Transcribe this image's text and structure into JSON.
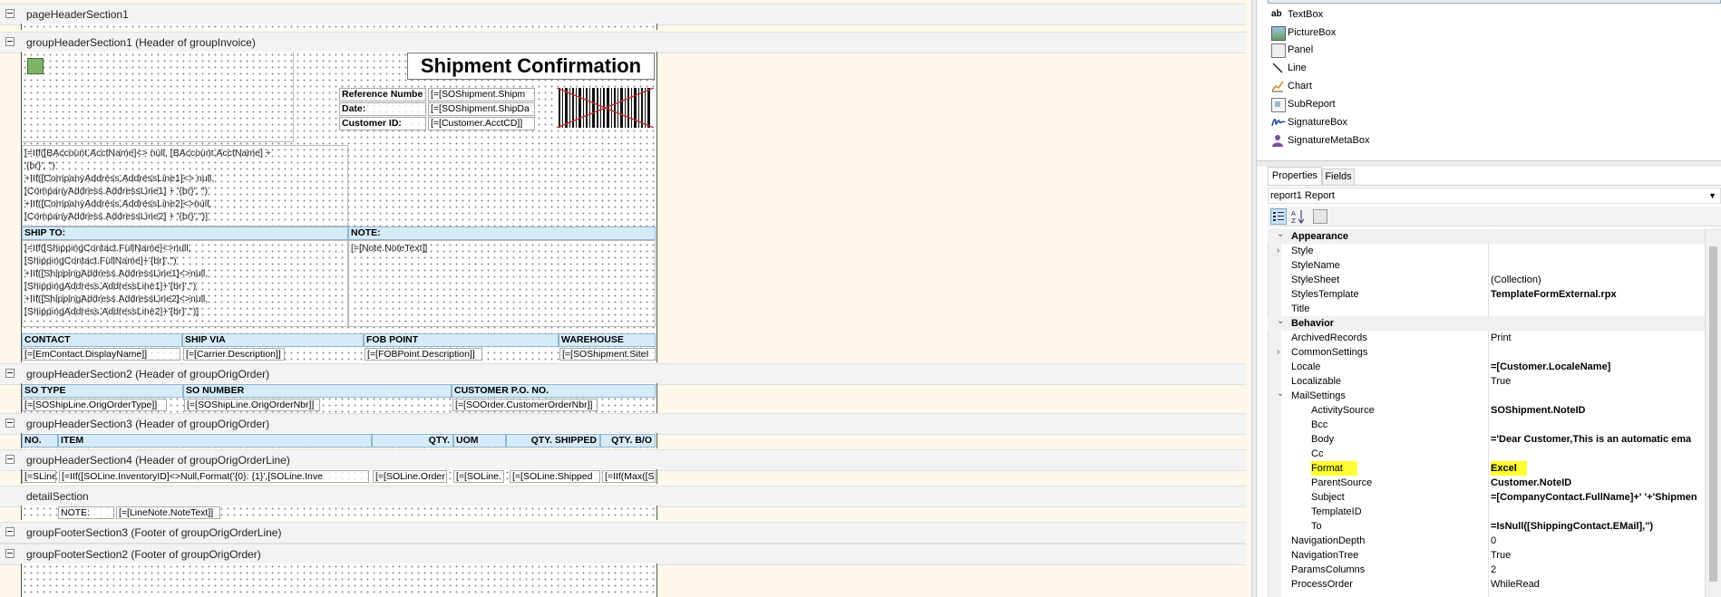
{
  "sections": {
    "page_header_1": "pageHeaderSection1",
    "group_header_1": "groupHeaderSection1 (Header of groupInvoice)",
    "group_header_2": "groupHeaderSection2 (Header of groupOrigOrder)",
    "group_header_3": "groupHeaderSection3 (Header of groupOrigOrder)",
    "group_header_4": "groupHeaderSection4 (Header of groupOrigOrderLine)",
    "detail": "detailSection",
    "group_footer_3": "groupFooterSection3 (Footer of groupOrigOrderLine)",
    "group_footer_2": "groupFooterSection2 (Footer of groupOrigOrder)"
  },
  "report": {
    "title": "Shipment Confirmation",
    "ref_label": "Reference Numbe",
    "ref_value": "[=[SOShipment.Shipm",
    "date_label": "Date:",
    "date_value": "[=[SOShipment.ShipDa",
    "cust_label": "Customer ID:",
    "cust_value": "[=[Customer.AcctCD]]",
    "addr_lines": [
      "[=IIf([BAccount.AcctName]<> null, [BAccount.AcctName] +",
      "'{br}', '')",
      "+IIf([CompanyAddress.AddressLine1]<> null,",
      "[CompanyAddress.AddressLine1] + '{br}', '')",
      "+IIf([CompanyAddress.AddressLine2]<>null,",
      "[CompanyAddress.AddressLine2] + '{br}','')]"
    ],
    "ship_to_label": "SHIP TO:",
    "note_label": "NOTE:",
    "ship_lines": [
      "[=IIf([ShippingContact.FullName]<>null,",
      "[ShippingContact.FullName]+'{br}','')",
      "+IIf([ShippingAddress.AddressLine1]<>null,",
      "[ShippingAddress.AddressLine1]+'{br}','')",
      "+IIf([ShippingAddress.AddressLine2]<>null,",
      "[ShippingAddress.AddressLine2]+'{br}','')]"
    ],
    "note_text": "[=[Note.NoteText]]",
    "contact_hdr": "CONTACT",
    "shipvia_hdr": "SHIP VIA",
    "fob_hdr": "FOB POINT",
    "warehouse_hdr": "WAREHOUSE",
    "contact_val": "[=[EmContact.DisplayName]]",
    "shipvia_val": "[=[Carrier.Description]]",
    "fob_val": "[=[FOBPoint.Description]]",
    "warehouse_val": "[=[SOShipment.SiteI",
    "sotype_hdr": "SO TYPE",
    "sonumber_hdr": "SO NUMBER",
    "custpo_hdr": "CUSTOMER P.O. NO.",
    "sotype_val": "[=[SOShipLine.OrigOrderType]]",
    "sonumber_val": "[=[SOShipLine.OrigOrderNbr]]",
    "custpo_val": "[=[SOOrder.CustomerOrderNbr]]",
    "no_hdr": "NO.",
    "item_hdr": "ITEM",
    "qty_hdr": "QTY.",
    "uom_hdr": "UOM",
    "qtyshipped_hdr": "QTY. SHIPPED",
    "qtybo_hdr": "QTY. B/O",
    "line_vals": [
      "[=SLine",
      "[=IIf([SOLine.InventoryID]<>Null,Format('{0}: {1}',[SOLine.Inve",
      "[=[SOLine.Order",
      "[=[SOLine.",
      "[=[SOLine.Shipped",
      "[=IIf(Max([SOS"
    ],
    "detail_note_label": "NOTE:",
    "detail_note_val": "[=[LineNote.NoteText]]"
  },
  "toolbox": {
    "items": [
      {
        "label": "TextBox",
        "icon": "textbox-icon"
      },
      {
        "label": "PictureBox",
        "icon": "picturebox-icon"
      },
      {
        "label": "Panel",
        "icon": "panel-icon"
      },
      {
        "label": "Line",
        "icon": "line-icon"
      },
      {
        "label": "Chart",
        "icon": "chart-icon"
      },
      {
        "label": "SubReport",
        "icon": "subreport-icon"
      },
      {
        "label": "SignatureBox",
        "icon": "signaturebox-icon"
      },
      {
        "label": "SignatureMetaBox",
        "icon": "signaturemetabox-icon"
      }
    ],
    "textbox_glyph": "ab"
  },
  "properties": {
    "tab_properties": "Properties",
    "tab_fields": "Fields",
    "object_selector": "report1 Report",
    "highlight_color": "#ffff33",
    "rows": [
      {
        "name": "Appearance",
        "value": "",
        "cat": true
      },
      {
        "name": "Style",
        "value": "",
        "exp": true
      },
      {
        "name": "StyleName",
        "value": ""
      },
      {
        "name": "StyleSheet",
        "value": "(Collection)"
      },
      {
        "name": "StylesTemplate",
        "value": "TemplateFormExternal.rpx",
        "bold": true
      },
      {
        "name": "Title",
        "value": ""
      },
      {
        "name": "Behavior",
        "value": "",
        "cat": true
      },
      {
        "name": "ArchivedRecords",
        "value": "Print"
      },
      {
        "name": "CommonSettings",
        "value": "",
        "exp": true
      },
      {
        "name": "Locale",
        "value": "=[Customer.LocaleName]",
        "bold": true
      },
      {
        "name": "Localizable",
        "value": "True"
      },
      {
        "name": "MailSettings",
        "value": "",
        "open": true
      },
      {
        "name": "ActivitySource",
        "value": "SOShipment.NoteID",
        "bold": true,
        "sub": true
      },
      {
        "name": "Bcc",
        "value": "",
        "sub": true
      },
      {
        "name": "Body",
        "value": "='Dear Customer,This is an automatic ema",
        "bold": true,
        "sub": true
      },
      {
        "name": "Cc",
        "value": "",
        "sub": true
      },
      {
        "name": "Format",
        "value": "Excel",
        "bold": true,
        "sub": true,
        "hl": true
      },
      {
        "name": "ParentSource",
        "value": "Customer.NoteID",
        "bold": true,
        "sub": true
      },
      {
        "name": "Subject",
        "value": "=[CompanyContact.FullName]+' '+'Shipmen",
        "bold": true,
        "sub": true
      },
      {
        "name": "TemplateID",
        "value": "",
        "sub": true
      },
      {
        "name": "To",
        "value": "=IsNull([ShippingContact.EMail],'')",
        "bold": true,
        "sub": true
      },
      {
        "name": "NavigationDepth",
        "value": "0"
      },
      {
        "name": "NavigationTree",
        "value": "True"
      },
      {
        "name": "ParamsColumns",
        "value": "2"
      },
      {
        "name": "ProcessOrder",
        "value": "WhileRead"
      }
    ]
  }
}
